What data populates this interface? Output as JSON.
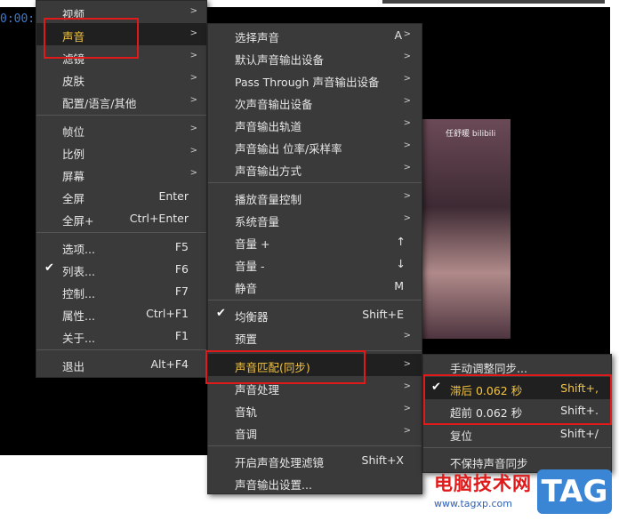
{
  "background": {
    "time_text": "0:00:",
    "video_overlay_text": "任舒暖 bilibili"
  },
  "main_menu": {
    "items": [
      {
        "label": "视频",
        "shortcut": "",
        "submenu": true
      },
      {
        "label": "声音",
        "shortcut": "",
        "submenu": true,
        "highlighted": true
      },
      {
        "label": "滤镜",
        "shortcut": "",
        "submenu": true
      },
      {
        "label": "皮肤",
        "shortcut": "",
        "submenu": true
      },
      {
        "label": "配置/语言/其他",
        "shortcut": "",
        "submenu": true
      },
      {
        "label": "帧位",
        "shortcut": "",
        "submenu": true
      },
      {
        "label": "比例",
        "shortcut": "",
        "submenu": true
      },
      {
        "label": "屏幕",
        "shortcut": "",
        "submenu": true
      },
      {
        "label": "全屏",
        "shortcut": "Enter",
        "submenu": false
      },
      {
        "label": "全屏+",
        "shortcut": "Ctrl+Enter",
        "submenu": false
      },
      {
        "label": "选项...",
        "shortcut": "F5",
        "submenu": false
      },
      {
        "label": "列表...",
        "shortcut": "F6",
        "submenu": false,
        "checked": true
      },
      {
        "label": "控制...",
        "shortcut": "F7",
        "submenu": false
      },
      {
        "label": "属性...",
        "shortcut": "Ctrl+F1",
        "submenu": false
      },
      {
        "label": "关于...",
        "shortcut": "F1",
        "submenu": false
      },
      {
        "label": "退出",
        "shortcut": "Alt+F4",
        "submenu": false
      }
    ]
  },
  "sound_menu": {
    "items": [
      {
        "label": "选择声音",
        "shortcut": "A"
      },
      {
        "label": "默认声音输出设备",
        "shortcut": ""
      },
      {
        "label": "Pass Through 声音输出设备",
        "shortcut": ""
      },
      {
        "label": "次声音输出设备",
        "shortcut": ""
      },
      {
        "label": "声音输出轨道",
        "shortcut": ""
      },
      {
        "label": "声音输出 位率/采样率",
        "shortcut": ""
      },
      {
        "label": "声音输出方式",
        "shortcut": ""
      },
      {
        "label": "播放音量控制",
        "shortcut": ""
      },
      {
        "label": "系统音量",
        "shortcut": ""
      },
      {
        "label": "音量 +",
        "shortcut": "↑"
      },
      {
        "label": "音量 -",
        "shortcut": "↓"
      },
      {
        "label": "静音",
        "shortcut": "M"
      },
      {
        "label": "均衡器",
        "shortcut": "Shift+E",
        "checked": true
      },
      {
        "label": "预置",
        "shortcut": ""
      },
      {
        "label": "声音匹配(同步)",
        "shortcut": "",
        "highlighted": true
      },
      {
        "label": "声音处理",
        "shortcut": ""
      },
      {
        "label": "音轨",
        "shortcut": ""
      },
      {
        "label": "音调",
        "shortcut": ""
      },
      {
        "label": "开启声音处理滤镜",
        "shortcut": "Shift+X"
      },
      {
        "label": "声音输出设置...",
        "shortcut": ""
      }
    ]
  },
  "sync_menu": {
    "items": [
      {
        "label": "手动调整同步...",
        "shortcut": ""
      },
      {
        "label": "滞后 0.062 秒",
        "shortcut": "Shift+,",
        "checked": true,
        "active": true
      },
      {
        "label": "超前 0.062 秒",
        "shortcut": "Shift+."
      },
      {
        "label": "复位",
        "shortcut": "Shift+/"
      },
      {
        "label": "不保持声音同步",
        "shortcut": ""
      }
    ]
  },
  "watermark": {
    "title": "电脑技术网",
    "url": "www.tagxp.com",
    "tag": "TAG"
  },
  "colors": {
    "menu_bg": "#3a3a3a",
    "highlight_bg": "#202020",
    "accent_yellow": "#f4c542",
    "annotation_red": "#e01a1a"
  }
}
